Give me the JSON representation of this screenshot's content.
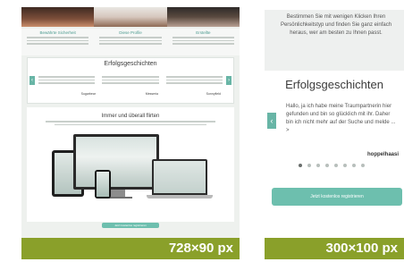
{
  "left": {
    "features": [
      {
        "title": "Bewährte Sicherheit"
      },
      {
        "title": "Diese Profile"
      },
      {
        "title": "Erstellte"
      }
    ],
    "success_title": "Erfolgsgeschichten",
    "success_names": [
      "Sugarbear",
      "Messeria",
      "Sonnyfield"
    ],
    "devices_title": "Immer und überall flirten",
    "cta_label": "Jetzt kostenlos registrieren",
    "size_label": "728×90 px"
  },
  "right": {
    "intro_text": "Bestimmen Sie mit wenigen Klicken Ihren Persönlichkeitstyp und finden Sie ganz einfach heraus, wer am besten zu Ihnen passt.",
    "title": "Erfolgsgeschichten",
    "story_text": "Hallo, ja ich habe meine Traumpartnerin hier gefunden und bin so glücklich mit ihr. Daher bin ich nicht mehr auf der Suche und melde ... >",
    "story_author": "hoppelhaasi",
    "dots_total": 8,
    "dots_active_index": 0,
    "cta_label": "Jetzt kostenlos registrieren",
    "size_label": "300×100 px"
  },
  "colors": {
    "accent": "#6dbfae",
    "badge": "#8aa02a"
  }
}
